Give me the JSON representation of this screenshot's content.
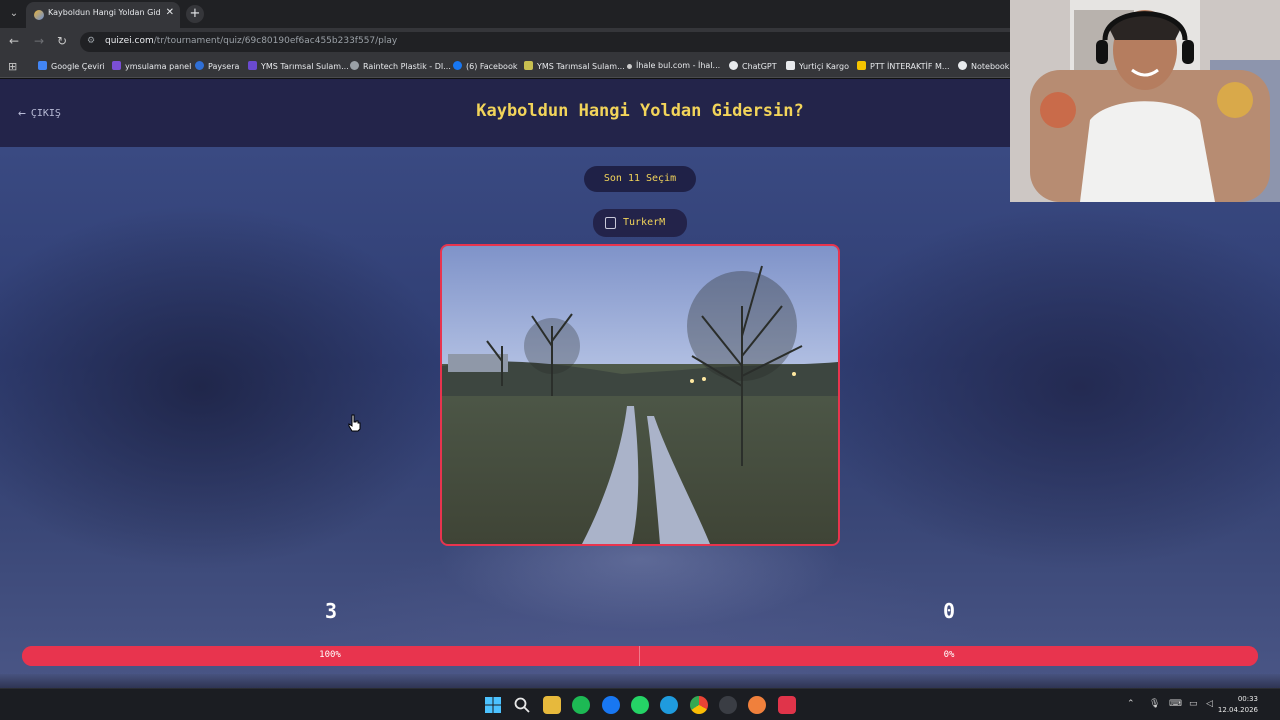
{
  "browser": {
    "tab_title": "Kayboldun Hangi Yoldan Gidersin?",
    "new_tab": "+",
    "close_tab": "✕",
    "url_host": "quizei.com",
    "url_path": "/tr/tournament/quiz/69c80190ef6ac455b233f557/play",
    "bookmarks": [
      {
        "label": "Google Çeviri",
        "color": "#4285f4"
      },
      {
        "label": "ymsulama panel",
        "color": "#7b4fd6"
      },
      {
        "label": "Paysera",
        "color": "#2f6fd6"
      },
      {
        "label": "YMS Tarımsal Sulam...",
        "color": "#6a4ad0"
      },
      {
        "label": "Raintech Plastik - DI...",
        "color": "#9aa0a6"
      },
      {
        "label": "(6) Facebook",
        "color": "#1877f2"
      },
      {
        "label": "YMS Tarımsal Sulam...",
        "color": "#c8c050"
      },
      {
        "label": "İhale bul.com - İhal...",
        "color": "#cccccc"
      },
      {
        "label": "ChatGPT",
        "color": "#e8eaed"
      },
      {
        "label": "Yurtiçi Kargo",
        "color": "#e8eaed"
      },
      {
        "label": "PTT İNTERAKTİF M...",
        "color": "#f5c400"
      },
      {
        "label": "NotebookL",
        "color": "#e8eaed"
      }
    ]
  },
  "quiz": {
    "exit_label": "ÇIKIŞ",
    "title": "Kayboldun Hangi Yoldan Gidersin?",
    "round_label": "Son 11 Seçim",
    "username": "TurkerM",
    "left_score": "3",
    "right_score": "0",
    "left_percent_label": "100%",
    "right_percent_label": "0%",
    "left_share": 1.0,
    "accent_color": "#e8344e",
    "title_color": "#f2d45a"
  },
  "taskbar": {
    "time": "00:33",
    "date": "12.04.2026"
  }
}
